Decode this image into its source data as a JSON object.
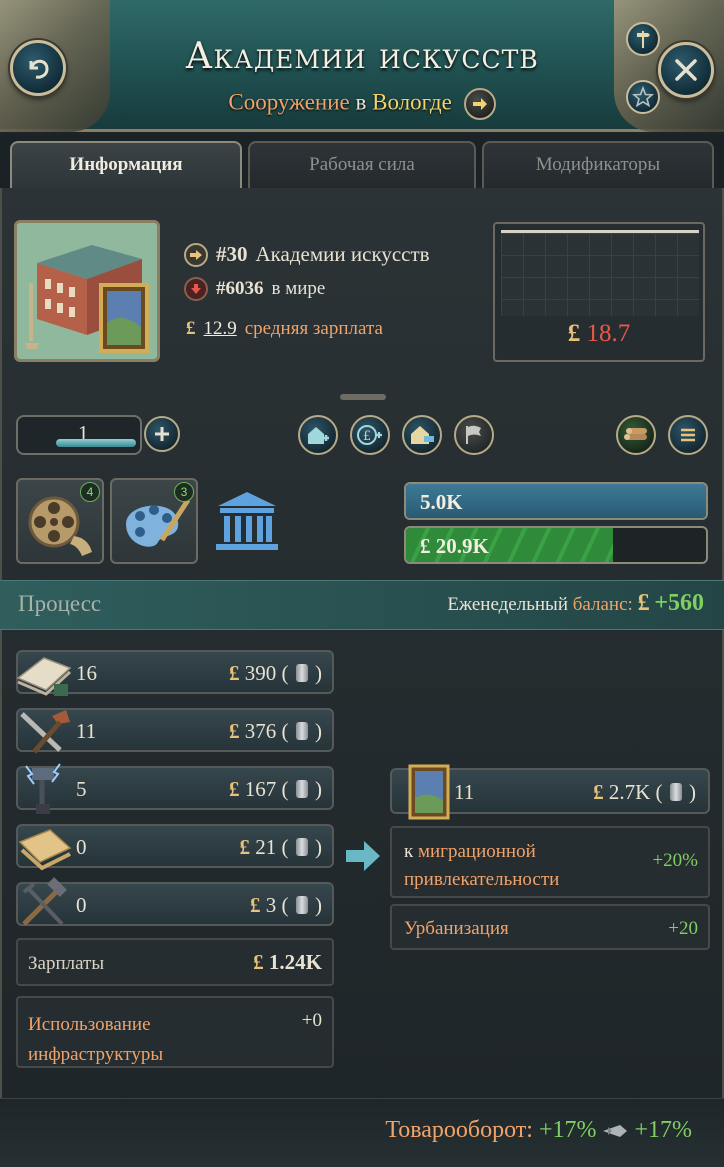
{
  "header": {
    "title": "Академии искусств",
    "subtitle_type": "Сооружение",
    "subtitle_in": "в",
    "subtitle_location": "Вологде"
  },
  "tabs": [
    {
      "label": "Информация",
      "active": true
    },
    {
      "label": "Рабочая сила",
      "active": false
    },
    {
      "label": "Модификаторы",
      "active": false
    }
  ],
  "info": {
    "rank_prefix": "#",
    "rank": "30",
    "rank_name": "Академии искусств",
    "world_rank_prefix": "#",
    "world_rank": "6036",
    "world_label": "в мире",
    "currency": "£",
    "avg_wage": "12.9",
    "avg_wage_label": "средняя зарплата"
  },
  "chart": {
    "currency": "£",
    "value": "18.7",
    "value_color": "#e8584a"
  },
  "level": {
    "value": "1",
    "progress": 1.0
  },
  "production_methods": [
    {
      "icon": "film-reel-icon",
      "count": "4"
    },
    {
      "icon": "palette-icon",
      "count": "3"
    },
    {
      "icon": "government-building-icon"
    }
  ],
  "bars": {
    "workforce_label": "5.0K",
    "workforce_fill": 1.0,
    "cash_label": "£ 20.9K",
    "cash_fill": 0.69
  },
  "process": {
    "title": "Процесс",
    "balance_label": "Еженедельный",
    "balance_word": "баланс:",
    "currency": "£",
    "balance_value": "+560"
  },
  "inputs": [
    {
      "icon": "paper-icon",
      "qty": "16",
      "price": "390",
      "currency": "£"
    },
    {
      "icon": "tools-icon",
      "qty": "11",
      "price": "376",
      "currency": "£"
    },
    {
      "icon": "electric-hammer-icon",
      "qty": "5",
      "price": "167",
      "currency": "£"
    },
    {
      "icon": "fabric-icon",
      "qty": "0",
      "price": "21",
      "currency": "£"
    },
    {
      "icon": "hammer-pliers-icon",
      "qty": "0",
      "price": "3",
      "currency": "£"
    }
  ],
  "wages": {
    "label": "Зарплаты",
    "currency": "£",
    "value": "1.24K"
  },
  "infrastructure": {
    "label_line1": "Использование",
    "label_line2": "инфраструктуры",
    "value": "+0"
  },
  "output": {
    "icon": "painting-icon",
    "qty": "11",
    "currency": "£",
    "price": "2.7K"
  },
  "modifiers": [
    {
      "prefix": "к",
      "label_line1": "миграционной",
      "label_line2": "привлекательности",
      "value": "+20%"
    },
    {
      "label": "Урбанизация",
      "value": "+20"
    }
  ],
  "trade": {
    "label": "Товарооборот:",
    "value1": "+17%",
    "value2": "+17%"
  },
  "colors": {
    "accent_orange": "#f0a36a",
    "positive_green": "#7fcf62",
    "negative_red": "#e8584a",
    "gold": "#f4d36c"
  }
}
